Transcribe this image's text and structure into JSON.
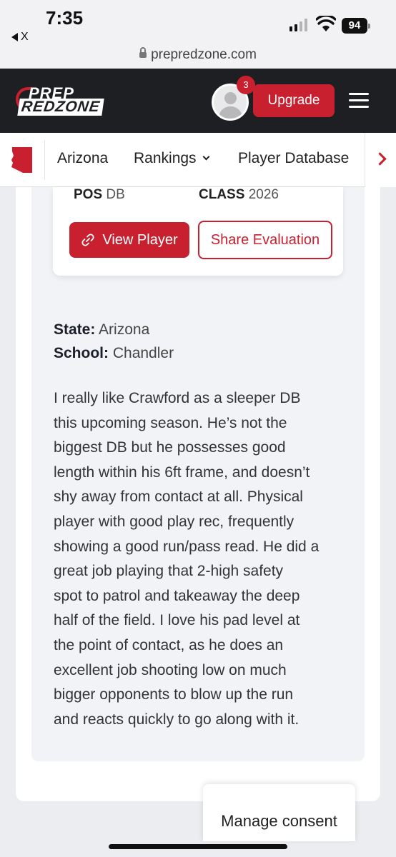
{
  "status_bar": {
    "time": "7:35",
    "back_app": "X",
    "battery": "94"
  },
  "browser": {
    "url": "prepredzone.com"
  },
  "header": {
    "logo_line1": "PREP",
    "logo_line2": "REDZONE",
    "notification_count": "3",
    "upgrade_label": "Upgrade"
  },
  "nav": {
    "items": [
      "Arizona",
      "Rankings",
      "Player Database"
    ]
  },
  "player": {
    "pos_label": "POS",
    "pos_value": "DB",
    "class_label": "CLASS",
    "class_value": "2026",
    "view_label": "View Player",
    "share_label": "Share Evaluation"
  },
  "details": {
    "state_label": "State:",
    "state_value": "Arizona",
    "school_label": "School:",
    "school_value": "Chandler"
  },
  "evaluation_lines": [
    "I really like Crawford as a sleeper DB",
    "this upcoming season. He’s not the",
    "biggest DB but he possesses good",
    "length within his 6ft frame, and doesn’t",
    "shy away from contact at all. Physical",
    "player with good play rec, frequently",
    "showing a good run/pass read. He did a",
    "great job playing that 2-high safety",
    "spot to patrol and takeaway the deep",
    "half of the field. I love his pad level at",
    "the point of contact, as he does an",
    "excellent job shooting low on much",
    "bigger opponents to blow up the run",
    "and reacts quickly to go along with it."
  ],
  "consent": {
    "label": "Manage consent"
  },
  "colors": {
    "brand_red": "#c8202f",
    "header_dark": "#1d1f22"
  }
}
